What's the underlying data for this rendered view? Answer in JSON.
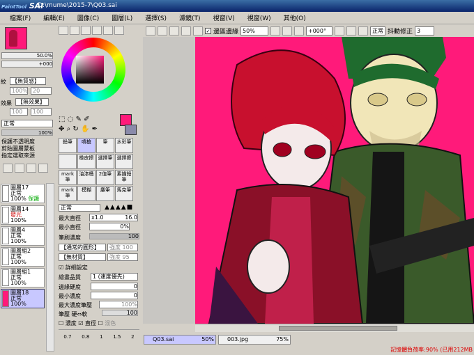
{
  "app": {
    "logo": "SAI",
    "logo_sub": "PaintTool",
    "title": "D:\\mume\\2015-7\\Q03.sai"
  },
  "menu": [
    "檔案(F)",
    "編輯(E)",
    "圖像(C)",
    "圖層(L)",
    "選擇(S)",
    "濾鏡(T)",
    "視窗(V)",
    "視窗(W)",
    "其他(O)"
  ],
  "toolbar": {
    "stabilize_label": "邊區邊緣",
    "zoom": "50%",
    "rotation": "+000°",
    "mode": "正常",
    "stabilizer_label": "抖動修正",
    "stabilizer_value": "3"
  },
  "navigator": {
    "zoom": "50.0%",
    "angle": "+000"
  },
  "layer_panel": {
    "texture_label": "紋",
    "texture_value": "【無質感】",
    "texture_pct": "100%",
    "texture_pct2": "20",
    "effect_label": "效果",
    "effect_value": "【無效果】",
    "effect_pct": "100",
    "effect_pct2": "100",
    "mode": "正常",
    "opacity": "100%",
    "checks": [
      "保護不透明度",
      "剪貼圖層蒙板",
      "指定選取來源"
    ],
    "layers": [
      {
        "name": "圖層17",
        "mode": "正常",
        "opacity": "100%",
        "extra": "保護"
      },
      {
        "name": "圖層14",
        "mode": "發光",
        "opacity": "100%",
        "extra": ""
      },
      {
        "name": "圖層4",
        "mode": "正常",
        "opacity": "100%",
        "extra": ""
      },
      {
        "name": "圖層組2",
        "mode": "正常",
        "opacity": "100%",
        "extra": ""
      },
      {
        "name": "圖層組1",
        "mode": "正常",
        "opacity": "100%",
        "extra": ""
      },
      {
        "name": "圖層18",
        "mode": "正常",
        "opacity": "100%",
        "extra": ""
      }
    ]
  },
  "tools": {
    "grid": [
      [
        "鉛筆",
        "噴槍",
        "筆",
        "水彩筆"
      ],
      [
        "",
        "橡皮擦",
        "選擇筆",
        "選擇擦"
      ],
      [
        "mark筆",
        "油漆桶",
        "2值筆",
        "素描鉛筆"
      ],
      [
        "mark筆",
        "模糊",
        "麈筆",
        "馬克筆"
      ]
    ],
    "mode": "正常",
    "max_size_label": "最大直徑",
    "max_size_mult": "x1.0",
    "max_size": "16.0",
    "min_size_label": "最小直徑",
    "min_size": "0%",
    "density_label": "筆刷濃度",
    "density": "100",
    "shape_label": "【通常的圓形】",
    "shape_val": "強度 100",
    "texture_label": "【無材質】",
    "texture_val": "強度 95",
    "detail_label": "詳細設定",
    "quality_label": "繪畫品質",
    "quality": "1 (速度優先)",
    "edge_label": "邊緣硬度",
    "edge": "0",
    "min_density_label": "最小濃度",
    "min_density": "0",
    "max_pressure_label": "最大濃度筆壓",
    "max_pressure": "100%",
    "pressure_label": "筆壓 硬⇔軟",
    "pressure": "100",
    "pressure_opts": [
      "濃度",
      "直徑",
      "混色"
    ],
    "sizes": [
      "0.7",
      "0.8",
      "1",
      "1.5",
      "2"
    ]
  },
  "tabs": [
    {
      "name": "Q03.sai",
      "zoom": "50%"
    },
    {
      "name": "003.jpg",
      "zoom": "75%"
    }
  ],
  "status": "記憶體負荷率:90% (已用212MB",
  "colors": {
    "canvas": "#ff1a7a",
    "primary": "#ff1a7a",
    "accent": "#0a246a"
  }
}
